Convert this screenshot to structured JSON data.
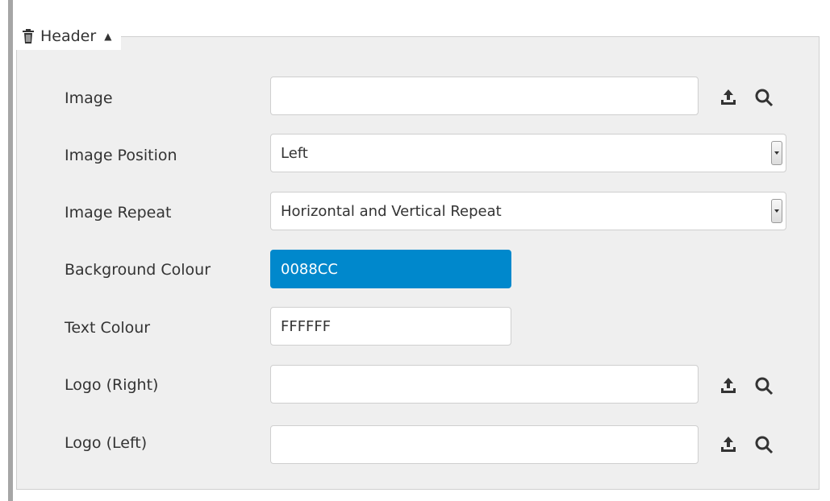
{
  "section": {
    "title": "Header",
    "icons": {
      "delete": "trash-icon",
      "collapse": "caret-up-icon"
    }
  },
  "fields": [
    {
      "label": "Image",
      "value": "",
      "type": "file",
      "icons": [
        "upload-icon",
        "search-icon"
      ]
    },
    {
      "label": "Image Position",
      "value": "Left",
      "type": "select"
    },
    {
      "label": "Image Repeat",
      "value": "Horizontal and Vertical Repeat",
      "type": "select"
    },
    {
      "label": "Background Colour",
      "value": "0088CC",
      "type": "color",
      "color": "#0088CC"
    },
    {
      "label": "Text Colour",
      "value": "FFFFFF",
      "type": "color",
      "color": "#FFFFFF"
    },
    {
      "label": "Logo (Right)",
      "value": "",
      "type": "file",
      "icons": [
        "upload-icon",
        "search-icon"
      ]
    },
    {
      "label": "Logo (Left)",
      "value": "",
      "type": "file",
      "icons": [
        "upload-icon",
        "search-icon"
      ]
    }
  ],
  "colors": {
    "fieldset_bg": "#EFEFEF",
    "border": "#CFCFCF",
    "left_bar": "#A6A6A6",
    "accent": "#0088CC"
  }
}
